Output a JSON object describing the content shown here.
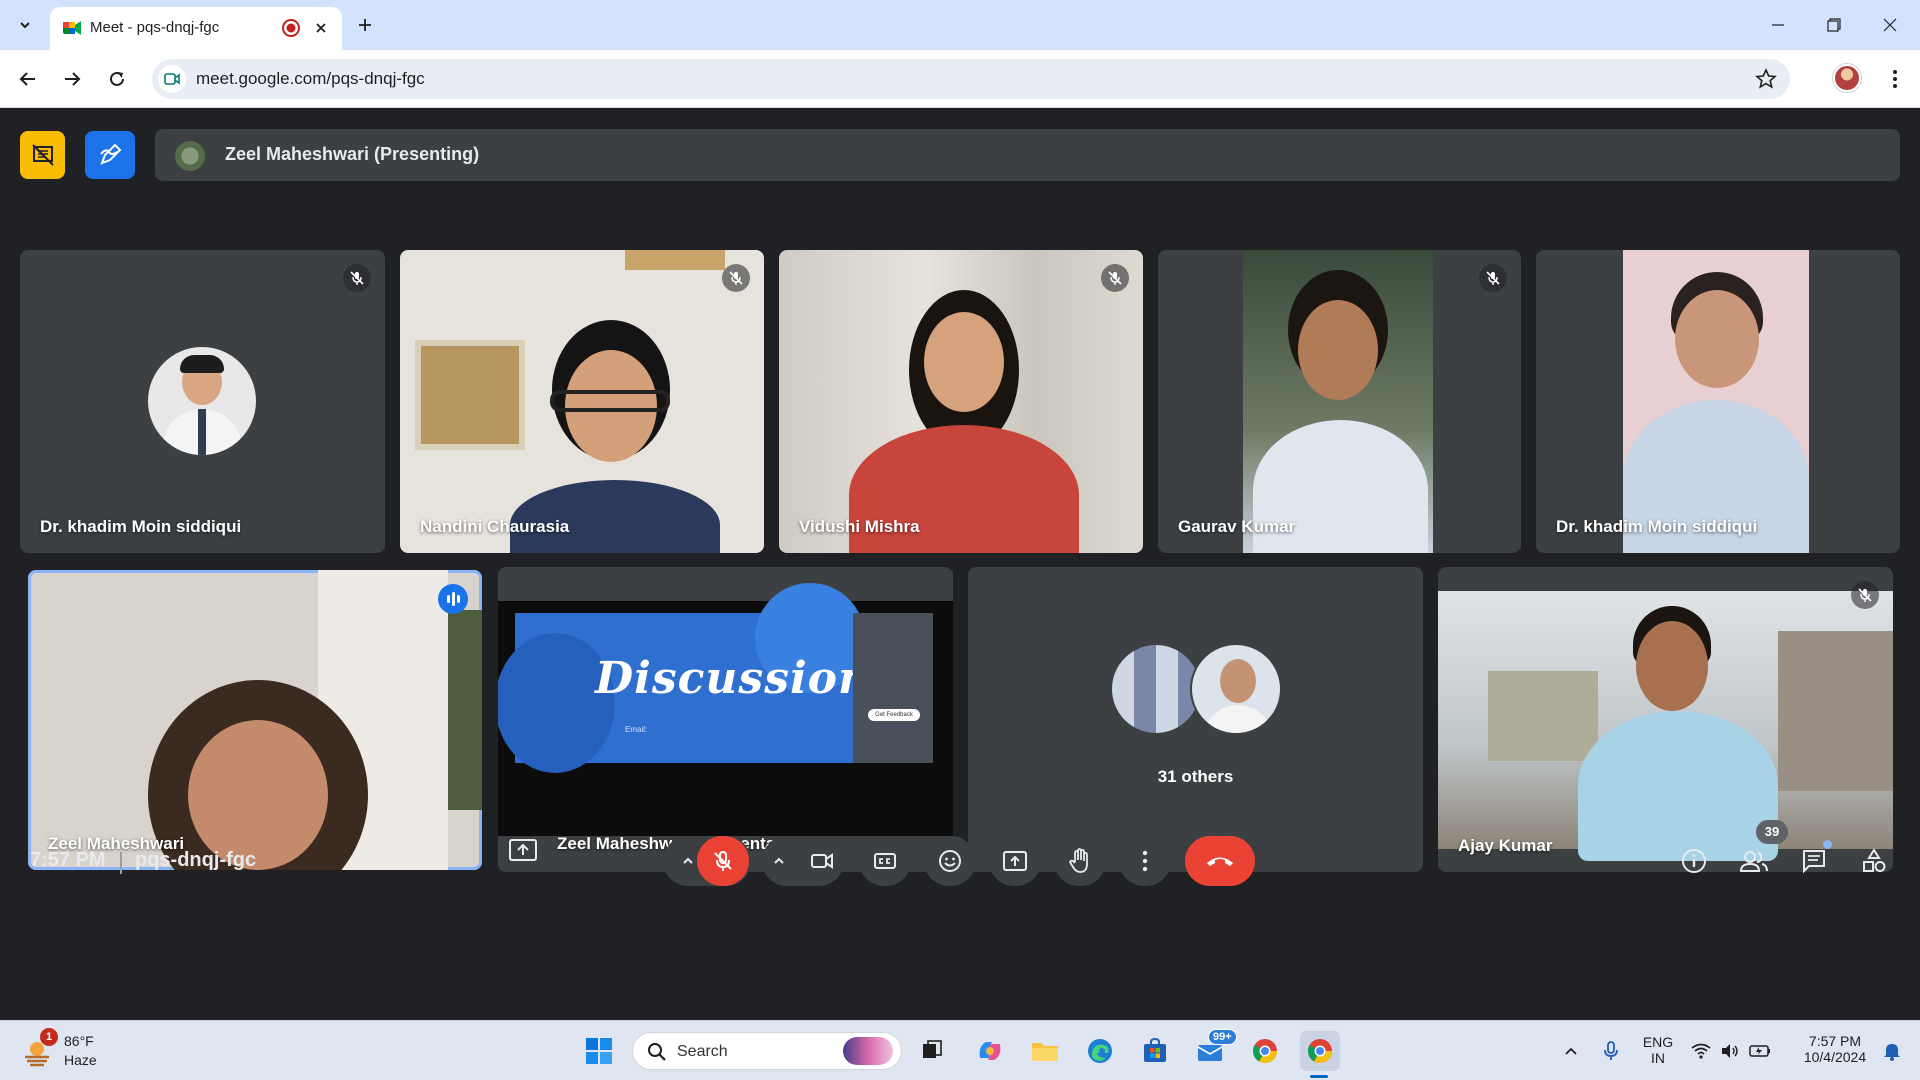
{
  "browser": {
    "tab_title": "Meet - pqs-dnqj-fgc",
    "url": "meet.google.com/pqs-dnqj-fgc"
  },
  "meet": {
    "presenting_label": "Zeel Maheshwari (Presenting)",
    "tiles_row1": [
      {
        "name": "Dr. khadim Moin siddiqui",
        "muted": true
      },
      {
        "name": "Nandini Chaurasia",
        "muted": true
      },
      {
        "name": "Vidushi Mishra",
        "muted": true
      },
      {
        "name": "Gaurav Kumar",
        "muted": true
      },
      {
        "name": "Dr. khadim Moin siddiqui",
        "muted": false
      }
    ],
    "tiles_row2": {
      "speaker": {
        "name": "Zeel Maheshwari",
        "speaking": true
      },
      "presentation": {
        "name": "Zeel Maheshwari (Presentation)",
        "slide_title": "Discussion",
        "slide_email": "Email:",
        "slide_button": "Get Feedback"
      },
      "others": {
        "label": "31 others"
      },
      "last": {
        "name": "Ajay Kumar",
        "muted": true
      }
    },
    "meeting_time": "7:57 PM",
    "meeting_code": "pqs-dnqj-fgc",
    "participants_count": "39",
    "colors": {
      "end_call": "#ea4335",
      "mic_off": "#ea4335",
      "accent": "#1a73e8",
      "yellow_tool": "#fbbc04"
    }
  },
  "taskbar": {
    "weather_temp": "86°F",
    "weather_cond": "Haze",
    "weather_badge": "1",
    "search_label": "Search",
    "store_badge": "99+",
    "lang_line1": "ENG",
    "lang_line2": "IN",
    "clock_time": "7:57 PM",
    "clock_date": "10/4/2024"
  }
}
